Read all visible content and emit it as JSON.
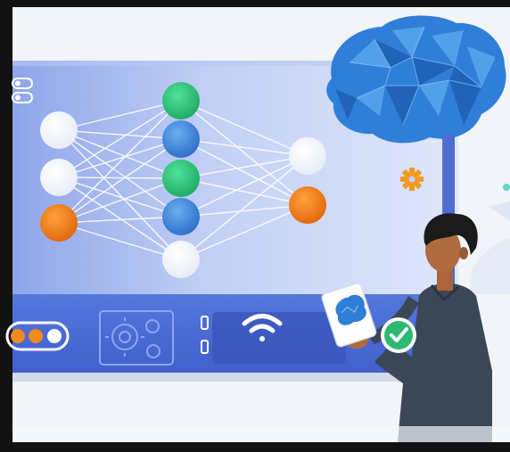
{
  "scene": {
    "kind": "neural-network-illustration",
    "colors": {
      "frame": "#121212",
      "background": "#f1f4f9",
      "panel_light": "#c9d6f3",
      "panel_mid": "#9fb5ec",
      "panel_dark": "#5f80d9",
      "bottom_bar": "#4a6ad6",
      "node_white": "#ffffff",
      "node_green": "#2fc27c",
      "node_blue": "#3f8ae0",
      "node_orange": "#f07d16",
      "brain": "#2f7fd8",
      "gear_orange": "#f29a22",
      "check_green": "#2eb872",
      "skin": "#b06a3f",
      "hair": "#1b1b1b",
      "shirt": "#3b4757"
    },
    "network": {
      "layers": [
        [
          "white",
          "white",
          "orange"
        ],
        [
          "green",
          "blue",
          "green",
          "blue",
          "white"
        ],
        [
          "white",
          "orange"
        ]
      ]
    },
    "toggle_dots": [
      "orange",
      "orange",
      "white"
    ],
    "icons": [
      "brain-icon",
      "gear-icon",
      "cog-panel-icon",
      "wifi-icon",
      "check-icon",
      "person-figure"
    ]
  }
}
